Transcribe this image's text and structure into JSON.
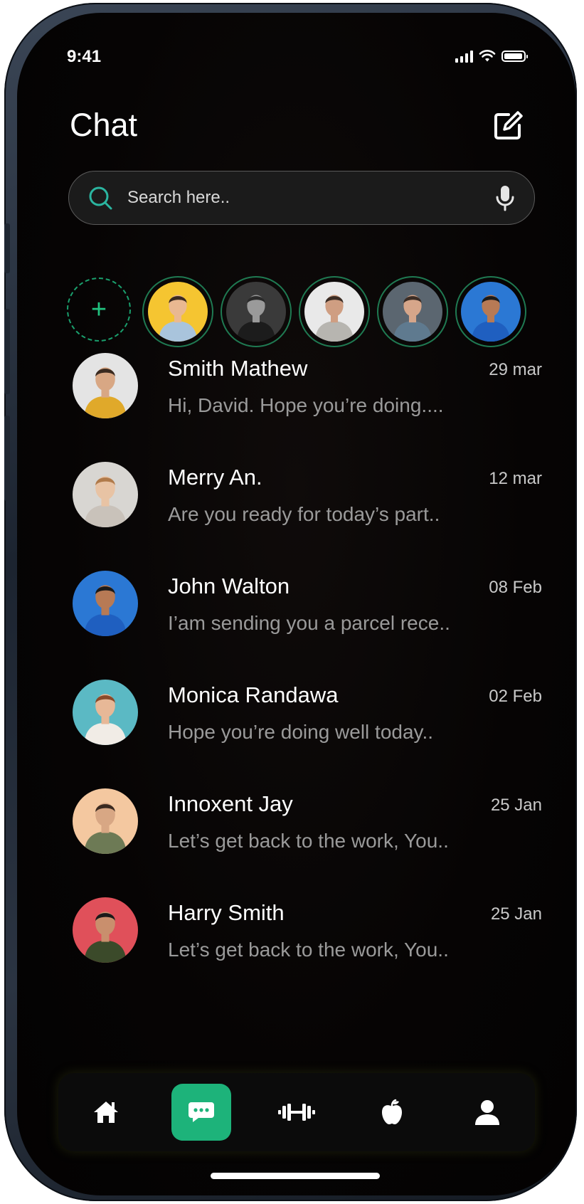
{
  "status_bar": {
    "time": "9:41"
  },
  "header": {
    "title": "Chat"
  },
  "search": {
    "placeholder": "Search here.."
  },
  "stories": [
    {
      "name": "story-1",
      "bg": "#f5c531",
      "shirt": "#a9c4dc",
      "skin": "#e9b891",
      "hair": "#3a2a20"
    },
    {
      "name": "story-2",
      "bg": "#3a3a3a",
      "shirt": "#1c1c1c",
      "skin": "#9a9a9a",
      "hair": "#2a2a2a"
    },
    {
      "name": "story-3",
      "bg": "#e9e9e9",
      "shirt": "#b7b5b0",
      "skin": "#cf9e82",
      "hair": "#3b2c24"
    },
    {
      "name": "story-4",
      "bg": "#5b6670",
      "shirt": "#5f7a8f",
      "skin": "#d6a68a",
      "hair": "#3b2c24"
    },
    {
      "name": "story-5",
      "bg": "#2b78d4",
      "shirt": "#1f5fc0",
      "skin": "#b77a55",
      "hair": "#1a1a1a"
    }
  ],
  "chats": [
    {
      "name": "Smith Mathew",
      "date": "29 mar",
      "message": "Hi, David. Hope you’re doing....",
      "bg": "#e4e4e4",
      "shirt": "#e0a92a",
      "skin": "#d8a784",
      "hair": "#3a2a20"
    },
    {
      "name": "Merry An.",
      "date": "12 mar",
      "message": "Are you ready for today’s part..",
      "bg": "#d8d6d2",
      "shirt": "#c9c2ba",
      "skin": "#e8c3a4",
      "hair": "#b07a4a"
    },
    {
      "name": "John Walton",
      "date": "08 Feb",
      "message": "I’am sending you a parcel rece..",
      "bg": "#2b78d4",
      "shirt": "#1f5fc0",
      "skin": "#b77a55",
      "hair": "#1a1a1a"
    },
    {
      "name": "Monica Randawa",
      "date": "02 Feb",
      "message": "Hope you’re doing well today..",
      "bg": "#5bb9c4",
      "shirt": "#f1ece6",
      "skin": "#e7b897",
      "hair": "#8a4a2a"
    },
    {
      "name": "Innoxent Jay",
      "date": "25 Jan",
      "message": "Let’s get back to the work, You..",
      "bg": "#f4c8a0",
      "shirt": "#6d7a55",
      "skin": "#d8a784",
      "hair": "#3a2a20"
    },
    {
      "name": "Harry Smith",
      "date": "25 Jan",
      "message": "Let’s get back to the work, You..",
      "bg": "#e0505a",
      "shirt": "#3b4a2a",
      "skin": "#c98f6d",
      "hair": "#1a1a1a"
    }
  ],
  "nav": [
    {
      "icon": "home-icon",
      "active": false
    },
    {
      "icon": "chat-icon",
      "active": true
    },
    {
      "icon": "dumbbell-icon",
      "active": false
    },
    {
      "icon": "apple-icon",
      "active": false
    },
    {
      "icon": "profile-icon",
      "active": false
    }
  ],
  "colors": {
    "accent": "#1db37a",
    "story_ring": "#1f7a52",
    "background": "#050303"
  }
}
